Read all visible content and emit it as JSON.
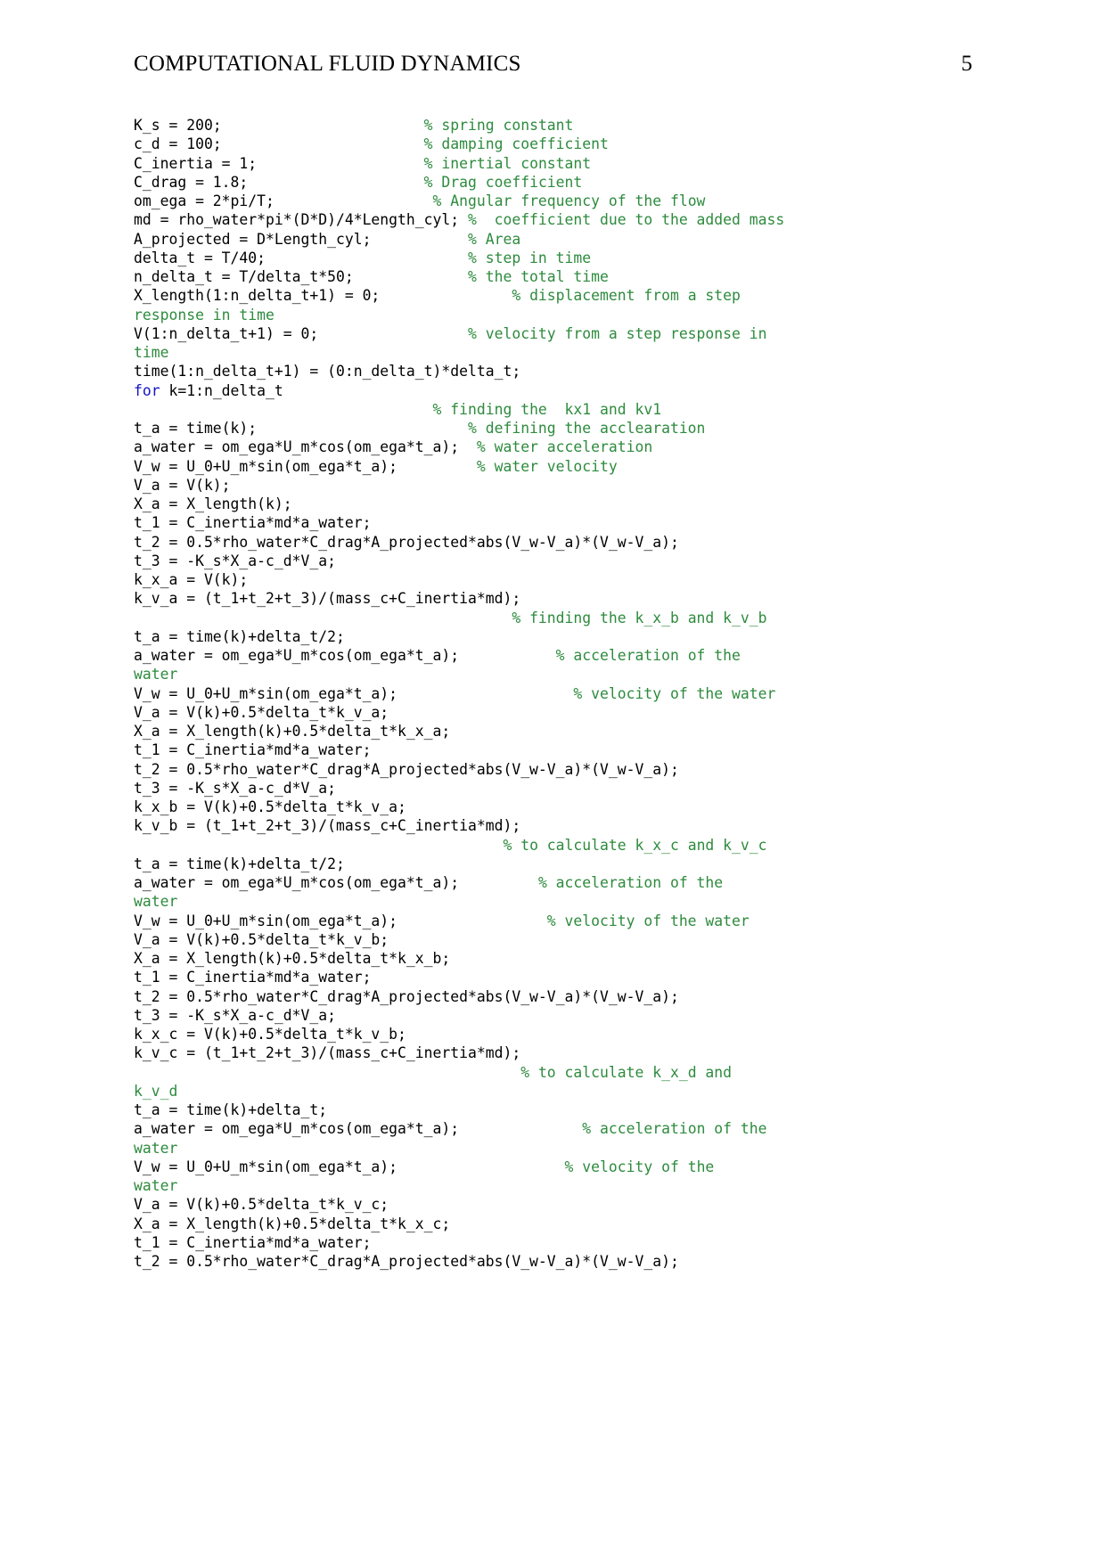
{
  "header": {
    "title": "COMPUTATIONAL FLUID DYNAMICS",
    "page_number": "5"
  },
  "colors": {
    "comment": "#2e8b3e",
    "keyword": "#1414c8",
    "code": "#000000",
    "background": "#ffffff"
  },
  "code": {
    "language": "MATLAB",
    "lines": [
      {
        "code": "K_s = 200;                       ",
        "comment": "% spring constant"
      },
      {
        "code": "c_d = 100;                       ",
        "comment": "% damping coefficient"
      },
      {
        "code": "C_inertia = 1;                   ",
        "comment": "% inertial constant"
      },
      {
        "code": "C_drag = 1.8;                    ",
        "comment": "% Drag coefficient"
      },
      {
        "code": "om_ega = 2*pi/T;                  ",
        "comment": "% Angular frequency of the flow"
      },
      {
        "code": "md = rho_water*pi*(D*D)/4*Length_cyl; ",
        "comment": "%  coefficient due to the added mass"
      },
      {
        "code": "A_projected = D*Length_cyl;           ",
        "comment": "% Area"
      },
      {
        "code": "delta_t = T/40;                       ",
        "comment": "% step in time"
      },
      {
        "code": "n_delta_t = T/delta_t*50;             ",
        "comment": "% the total time"
      },
      {
        "code": "X_length(1:n_delta_t+1) = 0;               ",
        "comment": "% displacement from a step"
      },
      {
        "code": "",
        "comment": "response in time"
      },
      {
        "code": "V(1:n_delta_t+1) = 0;                 ",
        "comment": "% velocity from a step response in"
      },
      {
        "code": "",
        "comment": "time"
      },
      {
        "code": "time(1:n_delta_t+1) = (0:n_delta_t)*delta_t;",
        "comment": ""
      },
      {
        "keyword": "for",
        "code": " k=1:n_delta_t",
        "comment": ""
      },
      {
        "code": "                                  ",
        "comment": "% finding the  kx1 and kv1"
      },
      {
        "code": "t_a = time(k);                        ",
        "comment": "% defining the acclearation"
      },
      {
        "code": "a_water = om_ega*U_m*cos(om_ega*t_a);  ",
        "comment": "% water acceleration"
      },
      {
        "code": "V_w = U_0+U_m*sin(om_ega*t_a);         ",
        "comment": "% water velocity"
      },
      {
        "code": "V_a = V(k);",
        "comment": ""
      },
      {
        "code": "X_a = X_length(k);",
        "comment": ""
      },
      {
        "code": "t_1 = C_inertia*md*a_water;",
        "comment": ""
      },
      {
        "code": "t_2 = 0.5*rho_water*C_drag*A_projected*abs(V_w-V_a)*(V_w-V_a);",
        "comment": ""
      },
      {
        "code": "t_3 = -K_s*X_a-c_d*V_a;",
        "comment": ""
      },
      {
        "code": "k_x_a = V(k);",
        "comment": ""
      },
      {
        "code": "k_v_a = (t_1+t_2+t_3)/(mass_c+C_inertia*md);",
        "comment": ""
      },
      {
        "code": "                                           ",
        "comment": "% finding the k_x_b and k_v_b"
      },
      {
        "code": "t_a = time(k)+delta_t/2;",
        "comment": ""
      },
      {
        "code": "a_water = om_ega*U_m*cos(om_ega*t_a);           ",
        "comment": "% acceleration of the"
      },
      {
        "code": "",
        "comment": "water"
      },
      {
        "code": "V_w = U_0+U_m*sin(om_ega*t_a);                    ",
        "comment": "% velocity of the water"
      },
      {
        "code": "V_a = V(k)+0.5*delta_t*k_v_a;",
        "comment": ""
      },
      {
        "code": "X_a = X_length(k)+0.5*delta_t*k_x_a;",
        "comment": ""
      },
      {
        "code": "t_1 = C_inertia*md*a_water;",
        "comment": ""
      },
      {
        "code": "t_2 = 0.5*rho_water*C_drag*A_projected*abs(V_w-V_a)*(V_w-V_a);",
        "comment": ""
      },
      {
        "code": "t_3 = -K_s*X_a-c_d*V_a;",
        "comment": ""
      },
      {
        "code": "k_x_b = V(k)+0.5*delta_t*k_v_a;",
        "comment": ""
      },
      {
        "code": "k_v_b = (t_1+t_2+t_3)/(mass_c+C_inertia*md);",
        "comment": ""
      },
      {
        "code": "                                          ",
        "comment": "% to calculate k_x_c and k_v_c"
      },
      {
        "code": "t_a = time(k)+delta_t/2;",
        "comment": ""
      },
      {
        "code": "a_water = om_ega*U_m*cos(om_ega*t_a);         ",
        "comment": "% acceleration of the"
      },
      {
        "code": "",
        "comment": "water"
      },
      {
        "code": "V_w = U_0+U_m*sin(om_ega*t_a);                 ",
        "comment": "% velocity of the water"
      },
      {
        "code": "V_a = V(k)+0.5*delta_t*k_v_b;",
        "comment": ""
      },
      {
        "code": "X_a = X_length(k)+0.5*delta_t*k_x_b;",
        "comment": ""
      },
      {
        "code": "t_1 = C_inertia*md*a_water;",
        "comment": ""
      },
      {
        "code": "t_2 = 0.5*rho_water*C_drag*A_projected*abs(V_w-V_a)*(V_w-V_a);",
        "comment": ""
      },
      {
        "code": "t_3 = -K_s*X_a-c_d*V_a;",
        "comment": ""
      },
      {
        "code": "k_x_c = V(k)+0.5*delta_t*k_v_b;",
        "comment": ""
      },
      {
        "code": "k_v_c = (t_1+t_2+t_3)/(mass_c+C_inertia*md);",
        "comment": ""
      },
      {
        "code": "                                            ",
        "comment": "% to calculate k_x_d and"
      },
      {
        "code": "",
        "comment": "k_v_d"
      },
      {
        "code": "t_a = time(k)+delta_t;",
        "comment": ""
      },
      {
        "code": "a_water = om_ega*U_m*cos(om_ega*t_a);              ",
        "comment": "% acceleration of the"
      },
      {
        "code": "",
        "comment": "water"
      },
      {
        "code": "V_w = U_0+U_m*sin(om_ega*t_a);                   ",
        "comment": "% velocity of the"
      },
      {
        "code": "",
        "comment": "water"
      },
      {
        "code": "V_a = V(k)+0.5*delta_t*k_v_c;",
        "comment": ""
      },
      {
        "code": "X_a = X_length(k)+0.5*delta_t*k_x_c;",
        "comment": ""
      },
      {
        "code": "t_1 = C_inertia*md*a_water;",
        "comment": ""
      },
      {
        "code": "t_2 = 0.5*rho_water*C_drag*A_projected*abs(V_w-V_a)*(V_w-V_a);",
        "comment": ""
      }
    ]
  }
}
